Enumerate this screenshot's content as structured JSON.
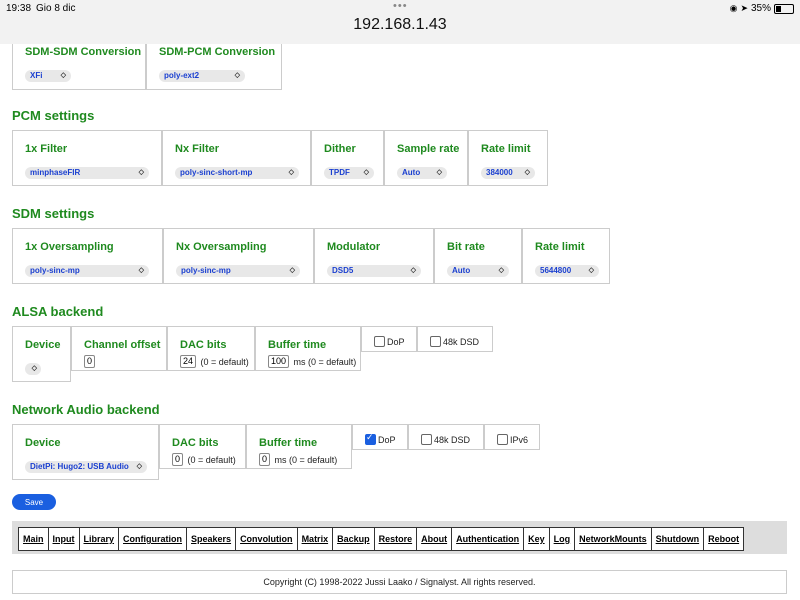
{
  "statusbar": {
    "time": "19:38",
    "date": "Gio 8 dic",
    "url": "192.168.1.43",
    "battery": "35%"
  },
  "conversion": {
    "sdm_sdm": {
      "label": "SDM-SDM Conversion",
      "value": "XFi"
    },
    "sdm_pcm": {
      "label": "SDM-PCM Conversion",
      "value": "poly-ext2"
    }
  },
  "pcm": {
    "heading": "PCM settings",
    "filter1x": {
      "label": "1x Filter",
      "value": "minphaseFIR"
    },
    "filterNx": {
      "label": "Nx Filter",
      "value": "poly-sinc-short-mp"
    },
    "dither": {
      "label": "Dither",
      "value": "TPDF"
    },
    "samplerate": {
      "label": "Sample rate",
      "value": "Auto"
    },
    "ratelimit": {
      "label": "Rate limit",
      "value": "384000"
    }
  },
  "sdm": {
    "heading": "SDM settings",
    "os1x": {
      "label": "1x Oversampling",
      "value": "poly-sinc-mp"
    },
    "osNx": {
      "label": "Nx Oversampling",
      "value": "poly-sinc-mp"
    },
    "modulator": {
      "label": "Modulator",
      "value": "DSD5"
    },
    "bitrate": {
      "label": "Bit rate",
      "value": "Auto"
    },
    "ratelimit": {
      "label": "Rate limit",
      "value": "5644800"
    }
  },
  "alsa": {
    "heading": "ALSA backend",
    "device": {
      "label": "Device",
      "value": ""
    },
    "channel_offset": {
      "label": "Channel offset",
      "value": "0"
    },
    "dac_bits": {
      "label": "DAC bits",
      "value": "24",
      "unit": "(0 = default)"
    },
    "buffer_time": {
      "label": "Buffer time",
      "value": "100",
      "unit": "ms (0 = default)"
    },
    "dop": {
      "label": "DoP",
      "checked": false
    },
    "dsd48k": {
      "label": "48k DSD",
      "checked": false
    }
  },
  "network": {
    "heading": "Network Audio backend",
    "device": {
      "label": "Device",
      "value": "DietPi: Hugo2: USB Audio"
    },
    "dac_bits": {
      "label": "DAC bits",
      "value": "0",
      "unit": "(0 = default)"
    },
    "buffer_time": {
      "label": "Buffer time",
      "value": "0",
      "unit": "ms (0 = default)"
    },
    "dop": {
      "label": "DoP",
      "checked": true
    },
    "dsd48k": {
      "label": "48k DSD",
      "checked": false
    },
    "ipv6": {
      "label": "IPv6",
      "checked": false
    }
  },
  "save_label": "Save",
  "nav": [
    "Main",
    "Input",
    "Library",
    "Configuration",
    "Speakers",
    "Convolution",
    "Matrix",
    "Backup",
    "Restore",
    "About",
    "Authentication",
    "Key",
    "Log",
    "NetworkMounts",
    "Shutdown",
    "Reboot"
  ],
  "footer": "Copyright (C) 1998-2022 Jussi Laako / Signalyst. All rights reserved."
}
